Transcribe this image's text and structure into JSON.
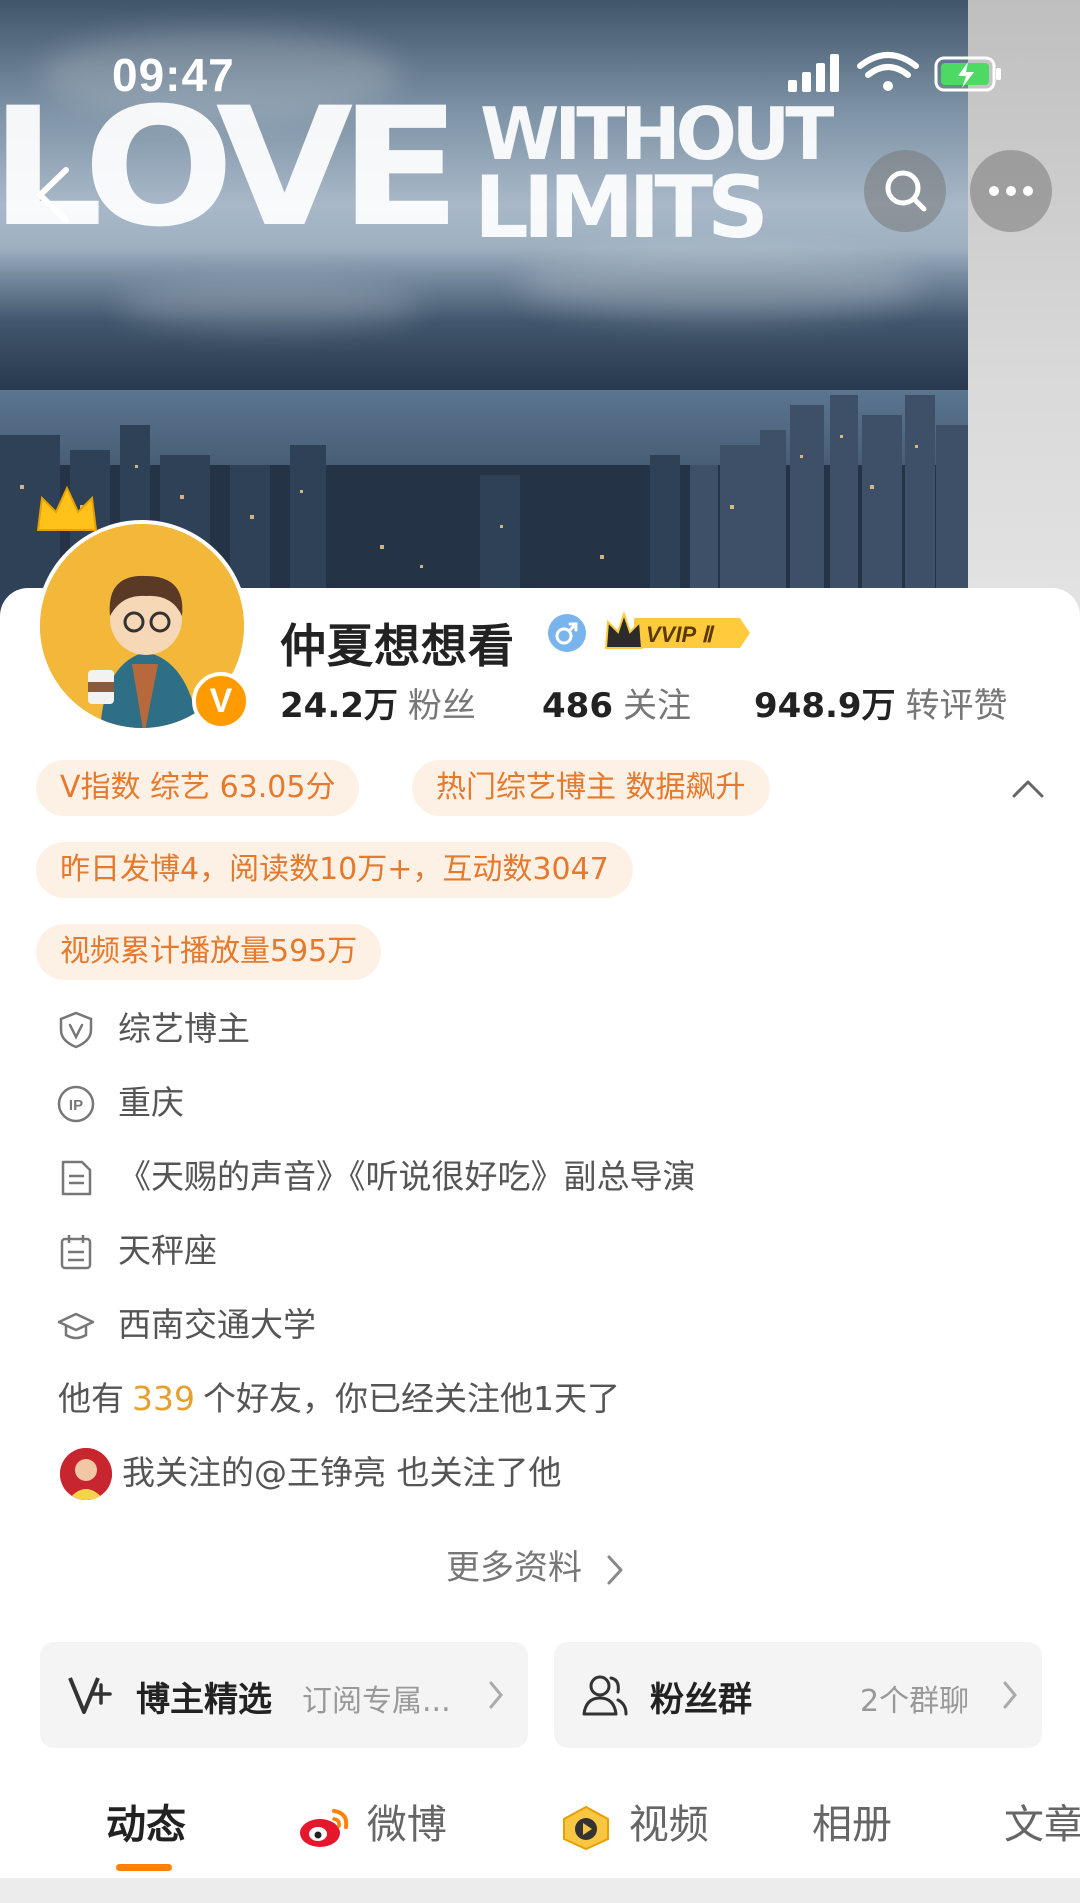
{
  "status_bar": {
    "time": "09:47"
  },
  "banner": {
    "line1": "LOVE",
    "line2": "WITHOUT",
    "line3": "LIMITS"
  },
  "profile": {
    "name": "仲夏想想看",
    "gender_symbol": "♂",
    "vip_label": "VVIP Ⅱ",
    "verified_mark": "V",
    "stats": [
      {
        "value": "24.2万",
        "label": "粉丝"
      },
      {
        "value": "486",
        "label": "关注"
      },
      {
        "value": "948.9万",
        "label": "转评赞"
      }
    ]
  },
  "tags": [
    "V指数 综艺 63.05分",
    "热门综艺博主 数据飙升",
    "昨日发博4，阅读数10万+，互动数3047",
    "视频累计播放量595万"
  ],
  "info": [
    {
      "icon": "shield-v-icon",
      "text": "综艺博主"
    },
    {
      "icon": "ip-icon",
      "text": "重庆"
    },
    {
      "icon": "document-icon",
      "text": "《天赐的声音》《听说很好吃》副总导演"
    },
    {
      "icon": "calendar-icon",
      "text": "天秤座"
    },
    {
      "icon": "graduation-cap-icon",
      "text": "西南交通大学"
    }
  ],
  "friends": {
    "prefix": "他有",
    "count": "339",
    "suffix": "个好友，你已经关注他1天了"
  },
  "mutual": {
    "text": "我关注的@王铮亮 也关注了他"
  },
  "more_info": {
    "label": "更多资料"
  },
  "boxes": {
    "featured": {
      "title": "博主精选",
      "subtitle": "订阅专属..."
    },
    "fan_group": {
      "title": "粉丝群",
      "subtitle": "2个群聊"
    }
  },
  "tabs": [
    "动态",
    "微博",
    "视频",
    "相册",
    "文章"
  ],
  "colors": {
    "accent": "#ff8200",
    "tag_text": "#e5792c",
    "tag_bg": "#fdf1e6",
    "highlight": "#e5a02d"
  }
}
